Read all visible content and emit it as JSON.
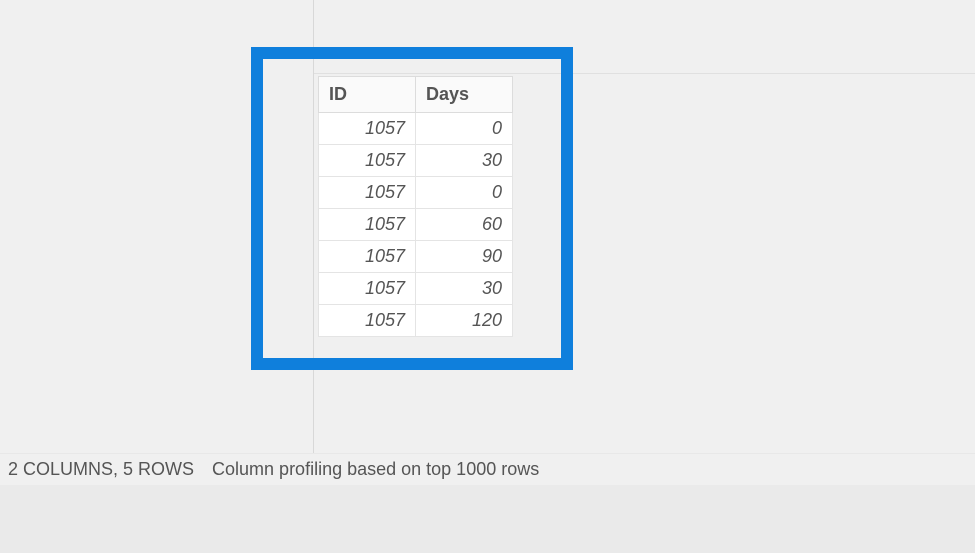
{
  "table": {
    "headers": [
      "ID",
      "Days"
    ],
    "rows": [
      {
        "id": "1057",
        "days": "0"
      },
      {
        "id": "1057",
        "days": "30"
      },
      {
        "id": "1057",
        "days": "0"
      },
      {
        "id": "1057",
        "days": "60"
      },
      {
        "id": "1057",
        "days": "90"
      },
      {
        "id": "1057",
        "days": "30"
      },
      {
        "id": "1057",
        "days": "120"
      }
    ]
  },
  "statusbar": {
    "columns_rows": "2 COLUMNS, 5 ROWS",
    "profiling": "Column profiling based on top 1000 rows"
  }
}
